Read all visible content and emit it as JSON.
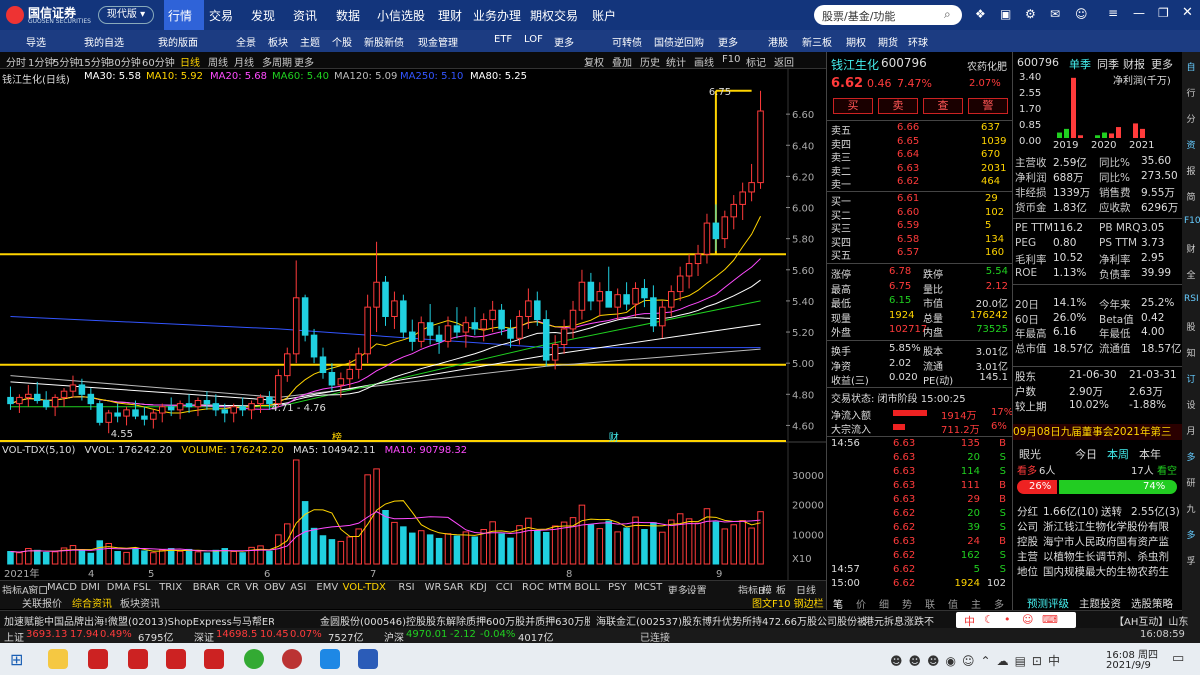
{
  "app": {
    "logo": "国信证券",
    "logo_sub": "GUOSEN SECURITIES",
    "edition": "现代版",
    "nav": [
      "行情",
      "交易",
      "发现",
      "资讯",
      "数据",
      "小信选股",
      "理财",
      "业务办理",
      "期权交易",
      "账户"
    ],
    "search_placeholder": "股票/基金/功能"
  },
  "toolbar": [
    "导选",
    "我的自选",
    "我的版面",
    "全景",
    "板块",
    "主题",
    "个股",
    "新股新债",
    "现金管理",
    "ETF",
    "LOF",
    "更多",
    "可转债",
    "国债逆回购",
    "更多",
    "港股",
    "新三板",
    "期权",
    "期货",
    "环球"
  ],
  "periods": [
    "分时",
    "1分钟",
    "5分钟",
    "15分钟",
    "30分钟",
    "60分钟",
    "日线",
    "周线",
    "月线",
    "多周期",
    "更多"
  ],
  "period_right": [
    "复权",
    "叠加",
    "历史",
    "统计",
    "画线",
    "F10",
    "标记",
    "返回"
  ],
  "chart_title": "钱江生化(日线)",
  "ma": [
    {
      "label": "MA30: 5.58",
      "color": "#ffffff"
    },
    {
      "label": "MA10: 5.92",
      "color": "#ffd400"
    },
    {
      "label": "MA20: 5.68",
      "color": "#ff4bff"
    },
    {
      "label": "MA60: 5.40",
      "color": "#20d020"
    },
    {
      "label": "MA120: 5.09",
      "color": "#bbbbbb"
    },
    {
      "label": "MA250: 5.10",
      "color": "#3355ff"
    },
    {
      "label": "MA80: 5.25",
      "color": "#ffffff"
    }
  ],
  "price_axis": [
    "6.60",
    "6.40",
    "6.20",
    "6.00",
    "5.80",
    "5.60",
    "5.40",
    "5.20",
    "5.00",
    "4.80",
    "4.60"
  ],
  "annot": {
    "high": "6.75",
    "range": "4.71 - 4.76",
    "low": "4.55",
    "b1": "榜",
    "b2": "财"
  },
  "vol": {
    "title": "VOL-TDX(5,10)",
    "vvol": "VVOL: 176242.20",
    "volume": "VOLUME: 176242.20",
    "ma5": "MA5: 104942.11",
    "ma10": "MA10: 90798.32",
    "axis": [
      "30000",
      "20000",
      "10000"
    ],
    "unit": "X10"
  },
  "xlabels": [
    "2021年",
    "4",
    "5",
    "6",
    "7",
    "8",
    "9"
  ],
  "indicators": [
    "指标A",
    "窗口",
    "MACD",
    "DMI",
    "DMA",
    "FSL",
    "TRIX",
    "BRAR",
    "CR",
    "VR",
    "OBV",
    "ASI",
    "EMV",
    "VOL-TDX",
    "RSI",
    "WR",
    "SAR",
    "KDJ",
    "CCI",
    "ROC",
    "MTM",
    "BOLL",
    "PSY",
    "MCST",
    "更多",
    "设置"
  ],
  "ind_right": [
    "指标B",
    "模",
    "板"
  ],
  "daylabel": "日线",
  "bottom_tabs": [
    "关联报价",
    "综合资讯",
    "板块资讯"
  ],
  "bottom_right": "图文F10 钢边栏",
  "quote": {
    "name": "钱江生化",
    "code": "600796",
    "sector": "农药化肥",
    "price": "6.62",
    "chg": "0.46",
    "pct": "7.47%",
    "sector_pct": "2.07%",
    "btns": [
      "买",
      "卖",
      "查",
      "警"
    ],
    "asks": [
      [
        "卖五",
        "6.66",
        "637"
      ],
      [
        "卖四",
        "6.65",
        "1039"
      ],
      [
        "卖三",
        "6.64",
        "670"
      ],
      [
        "卖二",
        "6.63",
        "2031"
      ],
      [
        "卖一",
        "6.62",
        "464"
      ]
    ],
    "bids": [
      [
        "买一",
        "6.61",
        "29"
      ],
      [
        "买二",
        "6.60",
        "102"
      ],
      [
        "买三",
        "6.59",
        "5"
      ],
      [
        "买四",
        "6.58",
        "134"
      ],
      [
        "买五",
        "6.57",
        "160"
      ]
    ],
    "stats": [
      [
        "涨停",
        "6.78",
        "跌停",
        "5.54"
      ],
      [
        "最高",
        "6.75",
        "量比",
        "2.12"
      ],
      [
        "最低",
        "6.15",
        "市值",
        "20.0亿"
      ],
      [
        "现量",
        "1924",
        "总量",
        "176242"
      ],
      [
        "外盘",
        "102717",
        "内盘",
        "73525"
      ]
    ],
    "stats2": [
      [
        "换手",
        "5.85%",
        "股本",
        "3.01亿"
      ],
      [
        "净资",
        "2.02",
        "流通",
        "3.01亿"
      ],
      [
        "收益(三)",
        "0.020",
        "PE(动)",
        "145.1"
      ]
    ],
    "status": "交易状态: 闭市阶段 15:00:25",
    "flow": [
      [
        "净流入额",
        "1914万",
        "17%"
      ],
      [
        "大宗流入",
        "711.2万",
        "6%"
      ]
    ],
    "ticks": [
      [
        "14:56",
        "6.63",
        "135",
        "B"
      ],
      [
        "",
        "6.63",
        "20",
        "S"
      ],
      [
        "",
        "6.63",
        "114",
        "S"
      ],
      [
        "",
        "6.63",
        "111",
        "B"
      ],
      [
        "",
        "6.63",
        "29",
        "B"
      ],
      [
        "",
        "6.62",
        "20",
        "S"
      ],
      [
        "",
        "6.62",
        "39",
        "S"
      ],
      [
        "",
        "6.63",
        "24",
        "B"
      ],
      [
        "",
        "6.62",
        "162",
        "S"
      ],
      [
        "14:57",
        "6.62",
        "5",
        "S"
      ],
      [
        "15:00",
        "6.62",
        "1924",
        "102"
      ]
    ],
    "tabs": [
      "笔",
      "价",
      "细",
      "势",
      "联",
      "值",
      "主",
      "多"
    ]
  },
  "fin": {
    "code": "600796",
    "tabs": [
      "单季",
      "同季",
      "财报",
      "更多"
    ],
    "chart_title": "净利润(千万)",
    "yaxis": [
      "3.40",
      "2.55",
      "1.70",
      "0.85",
      "0.00"
    ],
    "years": [
      "2019",
      "2020",
      "2021"
    ],
    "bars": [
      [
        0.3,
        0.5,
        3.3,
        0.15
      ],
      [
        0.15,
        0.3,
        0.25,
        0.6
      ],
      [
        0.8,
        0.5,
        0,
        0
      ]
    ],
    "rows": [
      [
        "主营收",
        "2.59亿",
        "同比%",
        "35.60"
      ],
      [
        "净利润",
        "688万",
        "同比%",
        "273.50"
      ],
      [
        "非经损",
        "1339万",
        "销售费",
        "9.55万"
      ],
      [
        "货币金",
        "1.83亿",
        "应收款",
        "6296万"
      ]
    ],
    "rows2": [
      [
        "PE TTM",
        "116.2",
        "PB MRQ",
        "3.05"
      ],
      [
        "PEG",
        "0.80",
        "PS TTM",
        "3.73"
      ],
      [
        "毛利率",
        "10.52",
        "净利率",
        "2.95"
      ],
      [
        "ROE",
        "1.13%",
        "负债率",
        "39.99"
      ]
    ],
    "rows3": [
      [
        "20日",
        "14.1%",
        "今年来",
        "25.2%"
      ],
      [
        "60日",
        "26.0%",
        "Beta值",
        "0.42"
      ],
      [
        "年最高",
        "6.16",
        "年最低",
        "4.00"
      ],
      [
        "总市值",
        "18.57亿",
        "流通值",
        "18.57亿"
      ]
    ],
    "rows4": [
      [
        "股东",
        "21-06-30",
        "21-03-31"
      ],
      [
        "户数",
        "2.90万",
        "2.63万"
      ],
      [
        "较上期",
        "10.02%",
        "-1.88%"
      ]
    ],
    "notice": "09月08日九届董事会2021年第三",
    "view": {
      "label": "眼光",
      "tabs": [
        "今日",
        "本周",
        "本年"
      ],
      "down": "看多",
      "down_n": "6人",
      "up_n": "17人",
      "up": "看空",
      "p1": "26%",
      "p2": "74%"
    },
    "company": [
      [
        "分红",
        "1.66亿(10)",
        "送转",
        "2.55亿(3)"
      ],
      [
        "公司",
        "浙江钱江生物化学股份有限"
      ],
      [
        "控股",
        "海宁市人民政府国有资产监"
      ],
      [
        "主营",
        "以植物生长调节剂、杀虫剂"
      ],
      [
        "地位",
        "国内规模最大的生物农药生"
      ]
    ],
    "foot": [
      "预测评级",
      "主题投资",
      "选股策略"
    ]
  },
  "sidebar": [
    "自",
    "行",
    "分",
    "资",
    "报",
    "简",
    "F10",
    "财",
    "全",
    "RSI",
    "股",
    "知",
    "订",
    "设",
    "月",
    "多",
    "研",
    "九",
    "多",
    "孚"
  ],
  "news": [
    "加速赋能中国品牌出海!微盟(02013)ShopExpress与马帮ERP达成合作",
    "金圆股份(000546)控股股东解除质押600万股并质押630万股",
    "海联金汇(002537)股东博升优势所持472.66万股公司股份被冻结",
    "港元拆息涨跌不",
    "【AH互动】山东"
  ],
  "market": [
    {
      "name": "上证",
      "val": "3693.13",
      "chg": "17.94",
      "pct": "0.49%",
      "amt": "6795亿"
    },
    {
      "name": "深证",
      "val": "14698.5",
      "chg": "10.45",
      "pct": "0.07%",
      "amt": "7527亿"
    },
    {
      "name": "沪深",
      "val": "4970.01",
      "chg": "-2.12",
      "pct": "-0.04%",
      "amt": "4017亿"
    }
  ],
  "connected": "已连接",
  "clock": "16:08:59",
  "taskbar": {
    "time": "16:08 周四",
    "date": "2021/9/9",
    "ime": "中"
  },
  "colors": {
    "up": "#ff3b3b",
    "down": "#20d0e0",
    "yellow": "#ffd400",
    "bg": "#000000"
  },
  "chart_data": {
    "type": "candlestick",
    "note": "daily K-line of 钱江生化 600796 with MA lines and volume",
    "candles": [
      [
        4.78,
        4.85,
        4.7,
        4.74
      ],
      [
        4.74,
        4.8,
        4.68,
        4.78
      ],
      [
        4.78,
        4.86,
        4.72,
        4.8
      ],
      [
        4.8,
        4.88,
        4.74,
        4.76
      ],
      [
        4.76,
        4.82,
        4.7,
        4.72
      ],
      [
        4.72,
        4.8,
        4.66,
        4.78
      ],
      [
        4.78,
        4.84,
        4.72,
        4.82
      ],
      [
        4.82,
        4.92,
        4.78,
        4.86
      ],
      [
        4.86,
        4.9,
        4.76,
        4.8
      ],
      [
        4.8,
        4.84,
        4.7,
        4.74
      ],
      [
        4.74,
        4.76,
        4.6,
        4.62
      ],
      [
        4.62,
        4.7,
        4.55,
        4.68
      ],
      [
        4.68,
        4.74,
        4.62,
        4.66
      ],
      [
        4.66,
        4.72,
        4.6,
        4.7
      ],
      [
        4.7,
        4.76,
        4.64,
        4.66
      ],
      [
        4.66,
        4.72,
        4.6,
        4.64
      ],
      [
        4.64,
        4.7,
        4.58,
        4.68
      ],
      [
        4.68,
        4.74,
        4.62,
        4.72
      ],
      [
        4.72,
        4.78,
        4.66,
        4.7
      ],
      [
        4.7,
        4.76,
        4.64,
        4.74
      ],
      [
        4.74,
        4.8,
        4.68,
        4.72
      ],
      [
        4.72,
        4.78,
        4.66,
        4.76
      ],
      [
        4.76,
        4.82,
        4.7,
        4.74
      ],
      [
        4.74,
        4.8,
        4.66,
        4.7
      ],
      [
        4.7,
        4.74,
        4.62,
        4.68
      ],
      [
        4.68,
        4.74,
        4.62,
        4.72
      ],
      [
        4.72,
        4.78,
        4.66,
        4.7
      ],
      [
        4.7,
        4.76,
        4.64,
        4.74
      ],
      [
        4.74,
        4.8,
        4.68,
        4.78
      ],
      [
        4.78,
        4.82,
        4.7,
        4.74
      ],
      [
        4.74,
        4.96,
        4.72,
        4.92
      ],
      [
        4.92,
        5.1,
        4.88,
        5.06
      ],
      [
        5.06,
        5.66,
        5.0,
        5.42
      ],
      [
        5.42,
        5.44,
        5.14,
        5.18
      ],
      [
        5.18,
        5.22,
        5.0,
        5.04
      ],
      [
        5.04,
        5.1,
        4.9,
        4.94
      ],
      [
        4.94,
        5.0,
        4.82,
        4.86
      ],
      [
        4.86,
        4.94,
        4.78,
        4.9
      ],
      [
        4.9,
        5.02,
        4.84,
        4.96
      ],
      [
        4.96,
        5.1,
        4.9,
        5.06
      ],
      [
        5.06,
        5.44,
        5.0,
        5.36
      ],
      [
        5.36,
        5.78,
        5.2,
        5.52
      ],
      [
        5.52,
        5.56,
        5.24,
        5.3
      ],
      [
        5.3,
        5.46,
        5.22,
        5.4
      ],
      [
        5.4,
        5.44,
        5.16,
        5.2
      ],
      [
        5.2,
        5.28,
        5.08,
        5.14
      ],
      [
        5.14,
        5.3,
        5.1,
        5.26
      ],
      [
        5.26,
        5.38,
        5.12,
        5.18
      ],
      [
        5.18,
        5.24,
        5.06,
        5.14
      ],
      [
        5.14,
        5.3,
        5.1,
        5.24
      ],
      [
        5.24,
        5.36,
        5.16,
        5.2
      ],
      [
        5.2,
        5.3,
        5.1,
        5.26
      ],
      [
        5.26,
        5.36,
        5.18,
        5.22
      ],
      [
        5.22,
        5.32,
        5.14,
        5.28
      ],
      [
        5.28,
        5.4,
        5.2,
        5.34
      ],
      [
        5.34,
        5.38,
        5.18,
        5.22
      ],
      [
        5.22,
        5.28,
        5.1,
        5.16
      ],
      [
        5.16,
        5.34,
        5.12,
        5.3
      ],
      [
        5.3,
        5.48,
        5.22,
        5.4
      ],
      [
        5.4,
        5.46,
        5.24,
        5.28
      ],
      [
        5.28,
        5.34,
        4.98,
        5.02
      ],
      [
        5.02,
        5.18,
        4.96,
        5.12
      ],
      [
        5.12,
        5.28,
        5.06,
        5.22
      ],
      [
        5.22,
        5.4,
        5.16,
        5.34
      ],
      [
        5.34,
        5.6,
        5.28,
        5.52
      ],
      [
        5.52,
        5.58,
        5.34,
        5.4
      ],
      [
        5.4,
        5.52,
        5.3,
        5.46
      ],
      [
        5.46,
        5.62,
        5.38,
        5.36
      ],
      [
        5.36,
        5.48,
        5.28,
        5.44
      ],
      [
        5.44,
        5.52,
        5.34,
        5.38
      ],
      [
        5.38,
        5.52,
        5.3,
        5.48
      ],
      [
        5.48,
        5.54,
        5.36,
        5.42
      ],
      [
        5.42,
        5.5,
        5.2,
        5.24
      ],
      [
        5.24,
        5.4,
        5.16,
        5.36
      ],
      [
        5.36,
        5.5,
        5.3,
        5.46
      ],
      [
        5.46,
        5.62,
        5.4,
        5.56
      ],
      [
        5.56,
        5.7,
        5.48,
        5.64
      ],
      [
        5.64,
        5.76,
        5.56,
        5.7
      ],
      [
        5.7,
        5.96,
        5.64,
        5.9
      ],
      [
        5.9,
        6.02,
        5.72,
        5.8
      ],
      [
        5.8,
        5.98,
        5.74,
        5.94
      ],
      [
        5.94,
        6.08,
        5.86,
        6.02
      ],
      [
        6.02,
        6.16,
        5.92,
        6.1
      ],
      [
        6.1,
        6.28,
        6.04,
        6.16
      ],
      [
        6.16,
        6.75,
        6.12,
        6.62
      ]
    ],
    "volume": [
      4200,
      3800,
      5200,
      4600,
      3900,
      4100,
      5400,
      6200,
      4800,
      3600,
      7800,
      6900,
      4200,
      3900,
      5100,
      4400,
      3800,
      4700,
      5200,
      4300,
      4900,
      4100,
      3700,
      4600,
      5200,
      4200,
      3800,
      5600,
      6100,
      4300,
      9800,
      13500,
      35000,
      21000,
      12000,
      9500,
      8200,
      7600,
      9100,
      11800,
      30000,
      32000,
      18000,
      14000,
      12500,
      10400,
      11200,
      9800,
      8600,
      10200,
      9400,
      10800,
      9100,
      11600,
      14200,
      10100,
      8700,
      12900,
      15400,
      11100,
      10600,
      12800,
      14100,
      15600,
      19800,
      13200,
      11900,
      14400,
      10800,
      12100,
      15800,
      11600,
      13900,
      10700,
      14800,
      16900,
      15200,
      13700,
      18600,
      14100,
      11800,
      13200,
      14600,
      12100,
      17600
    ],
    "price_ylim": [
      4.5,
      6.8
    ],
    "volume_ylim": [
      0,
      36000
    ],
    "hlines": [
      5.7,
      4.99,
      4.5
    ]
  }
}
